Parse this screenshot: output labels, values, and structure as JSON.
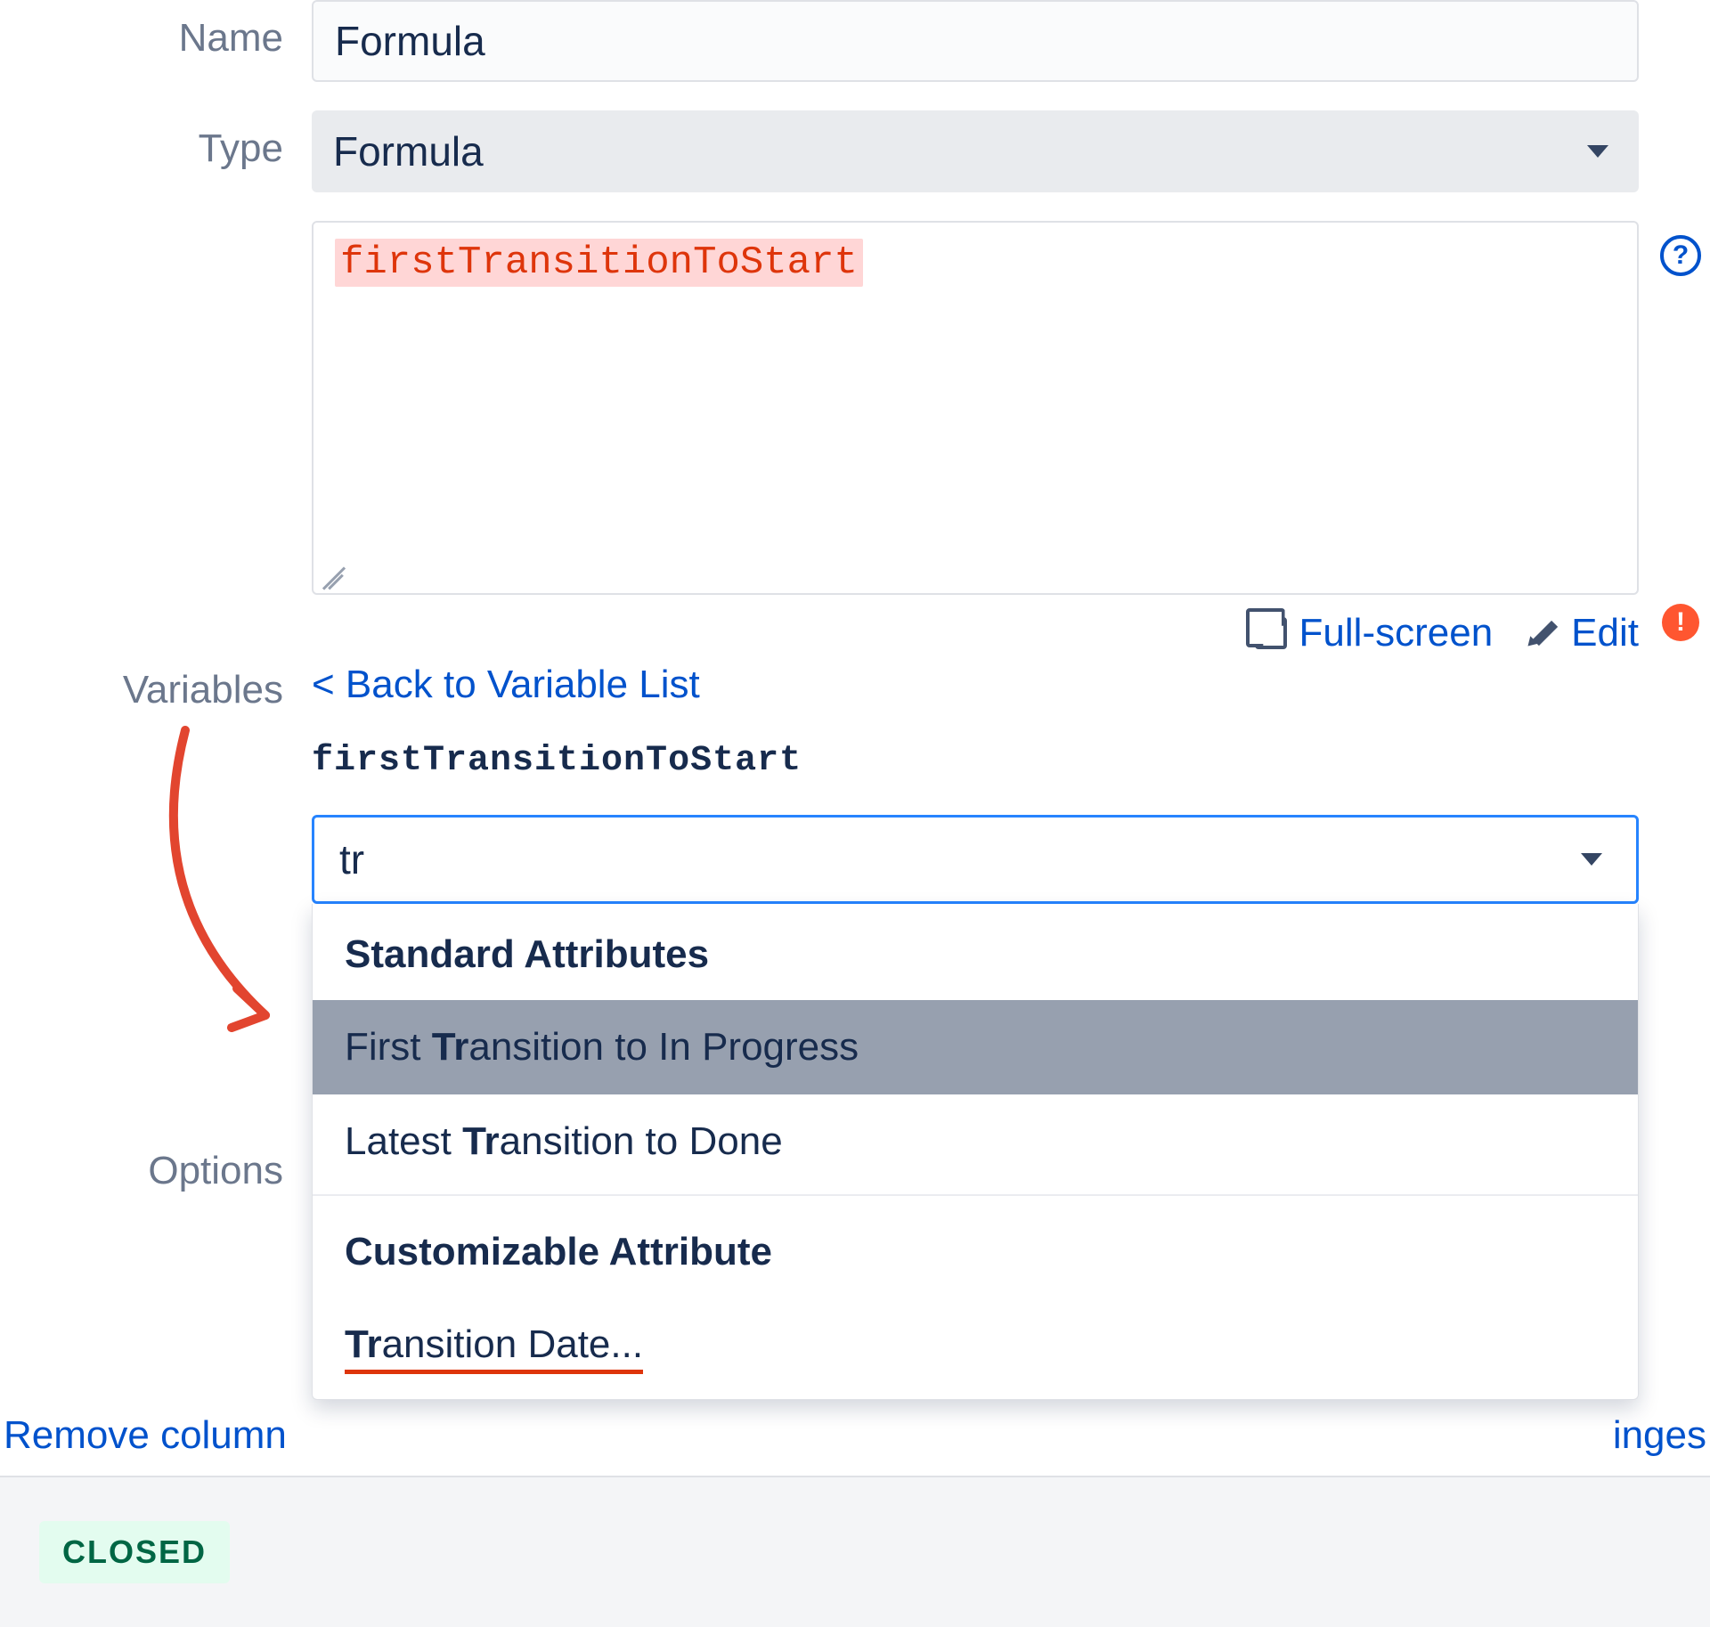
{
  "form": {
    "name_label": "Name",
    "name_value": "Formula",
    "type_label": "Type",
    "type_value": "Formula",
    "formula_text": "firstTransitionToStart",
    "fullscreen_label": "Full-screen",
    "edit_label": "Edit"
  },
  "variables": {
    "section_label": "Variables",
    "back_link": "< Back to Variable List",
    "var_name": "firstTransitionToStart",
    "search_value": "tr",
    "options_label": "Options"
  },
  "dropdown": {
    "group1_header": "Standard Attributes",
    "group1_items": [
      {
        "prefix": "First ",
        "match": "Tr",
        "rest": "ansition to In Progress",
        "hover": true
      },
      {
        "prefix": "Latest ",
        "match": "Tr",
        "rest": "ansition to Done",
        "hover": false
      }
    ],
    "group2_header": "Customizable Attribute",
    "group2_items": [
      {
        "prefix": "",
        "match": "Tr",
        "rest": "ansition Date...",
        "underlined": true
      }
    ]
  },
  "background": {
    "remove_link": "Remove column",
    "changes_link": "inges"
  },
  "footer": {
    "badge": "CLOSED"
  }
}
